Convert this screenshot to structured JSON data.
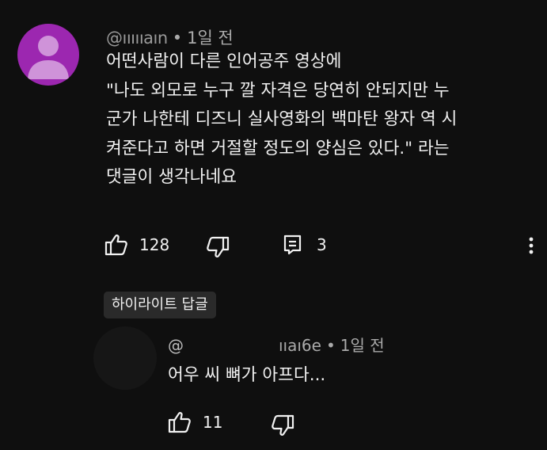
{
  "comment": {
    "author": "@ıııııaın",
    "time": "1일 전",
    "lines": [
      "어떤사람이 다른 인어공주 영상에",
      "\"나도 외모로 누구 깔 자격은 당연히 안되지만 누",
      "군가 나한테 디즈니 실사영화의 백마탄 왕자 역 시",
      "켜준다고 하면 거절할 정도의 양심은 있다.\" 라는",
      "댓글이 생각나네요"
    ],
    "likes": "128",
    "replies": "3",
    "avatar_color": "#9c27b0"
  },
  "highlight_label": "하이라이트 답글",
  "reply": {
    "author_start": "@",
    "author_end": "ııaı6e",
    "time": "1일 전",
    "text": "어우 씨 뼈가 아프다...",
    "likes": "11"
  },
  "icons": {
    "like": "thumbs-up-icon",
    "dislike": "thumbs-down-icon",
    "replies": "comment-icon",
    "more": "more-vertical-icon"
  }
}
